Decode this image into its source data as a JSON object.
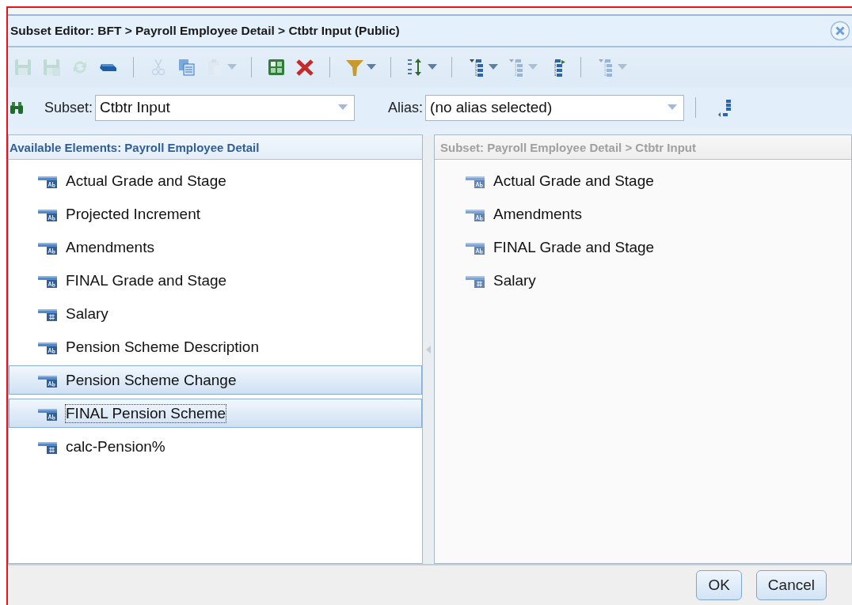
{
  "window": {
    "title": "Subset Editor: BFT > Payroll Employee Detail > Ctbtr Input (Public)"
  },
  "toolbar": [
    {
      "kind": "save",
      "disabled": true,
      "dropdown": false
    },
    {
      "kind": "save-as",
      "disabled": true,
      "dropdown": false
    },
    {
      "kind": "refresh",
      "disabled": true,
      "dropdown": false
    },
    {
      "kind": "bar",
      "disabled": false,
      "dropdown": false
    },
    {
      "kind": "separator"
    },
    {
      "kind": "cut",
      "disabled": true,
      "dropdown": false
    },
    {
      "kind": "copy",
      "disabled": false,
      "dropdown": false
    },
    {
      "kind": "paste",
      "disabled": true,
      "dropdown": true
    },
    {
      "kind": "separator"
    },
    {
      "kind": "grid",
      "disabled": false,
      "dropdown": false
    },
    {
      "kind": "delete",
      "disabled": false,
      "dropdown": false
    },
    {
      "kind": "separator"
    },
    {
      "kind": "filter",
      "disabled": false,
      "dropdown": true
    },
    {
      "kind": "separator"
    },
    {
      "kind": "sort",
      "disabled": false,
      "dropdown": true
    },
    {
      "kind": "separator"
    },
    {
      "kind": "tree",
      "disabled": false,
      "dropdown": true
    },
    {
      "kind": "tree",
      "disabled": true,
      "dropdown": true
    },
    {
      "kind": "tree-in",
      "disabled": false,
      "dropdown": false
    },
    {
      "kind": "separator"
    },
    {
      "kind": "tree-filter",
      "disabled": true,
      "dropdown": true
    }
  ],
  "subset": {
    "label": "Subset:",
    "value": "Ctbtr Input"
  },
  "alias": {
    "label": "Alias:",
    "value": "(no alias selected)"
  },
  "available": {
    "title": "Available Elements: Payroll Employee Detail",
    "items": [
      {
        "label": "Actual Grade and Stage",
        "kind": "text",
        "selected": false,
        "focused": false
      },
      {
        "label": "Projected Increment",
        "kind": "text",
        "selected": false,
        "focused": false
      },
      {
        "label": "Amendments",
        "kind": "text",
        "selected": false,
        "focused": false
      },
      {
        "label": "FINAL Grade and Stage",
        "kind": "text",
        "selected": false,
        "focused": false
      },
      {
        "label": "Salary",
        "kind": "numeric",
        "selected": false,
        "focused": false
      },
      {
        "label": "Pension Scheme Description",
        "kind": "text",
        "selected": false,
        "focused": false
      },
      {
        "label": "Pension Scheme Change",
        "kind": "text",
        "selected": true,
        "focused": false
      },
      {
        "label": "FINAL Pension Scheme",
        "kind": "text",
        "selected": true,
        "focused": true
      },
      {
        "label": "calc-Pension%",
        "kind": "numeric",
        "selected": false,
        "focused": false
      }
    ]
  },
  "subset_panel": {
    "title": "Subset: Payroll Employee Detail > Ctbtr Input",
    "items": [
      {
        "label": "Actual Grade and Stage",
        "kind": "text"
      },
      {
        "label": "Amendments",
        "kind": "text"
      },
      {
        "label": "FINAL Grade and Stage",
        "kind": "text"
      },
      {
        "label": "Salary",
        "kind": "numeric"
      }
    ]
  },
  "buttons": [
    "OK",
    "Cancel"
  ]
}
